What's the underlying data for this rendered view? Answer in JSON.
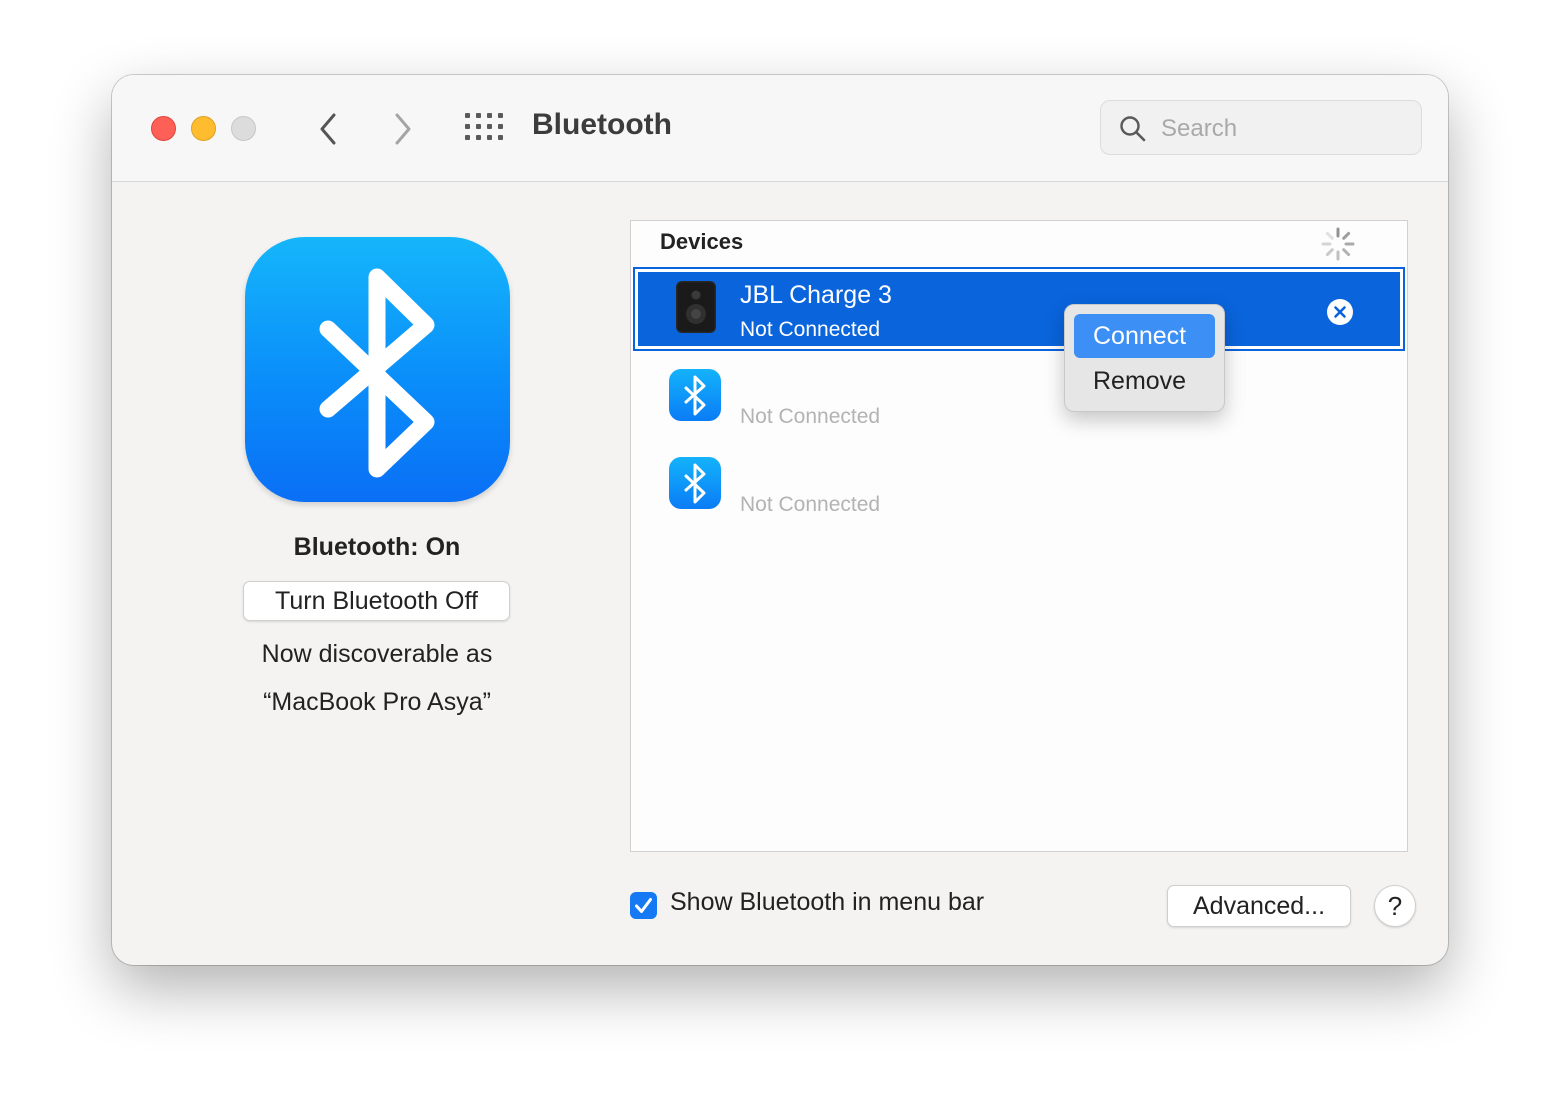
{
  "window": {
    "title": "Bluetooth",
    "search_placeholder": "Search"
  },
  "left": {
    "status": "Bluetooth: On",
    "toggle_label": "Turn Bluetooth Off",
    "discoverable_line1": "Now discoverable as",
    "discoverable_line2": "“MacBook Pro Asya”"
  },
  "devices": {
    "header": "Devices",
    "items": [
      {
        "name": "JBL Charge 3",
        "status": "Not Connected",
        "icon": "speaker-icon",
        "selected": true
      },
      {
        "name": "",
        "status": "Not Connected",
        "icon": "bluetooth-icon",
        "selected": false
      },
      {
        "name": "",
        "status": "Not Connected",
        "icon": "bluetooth-icon",
        "selected": false
      }
    ]
  },
  "context_menu": {
    "items": [
      "Connect",
      "Remove"
    ]
  },
  "footer": {
    "show_in_menu_bar_label": "Show Bluetooth in menu bar",
    "show_in_menu_bar_checked": true,
    "advanced_label": "Advanced...",
    "help_label": "?"
  },
  "colors": {
    "selection": "#0a64dc",
    "menu_highlight": "#3b8ff5",
    "bluetooth_blue": "#0a8dfa"
  }
}
